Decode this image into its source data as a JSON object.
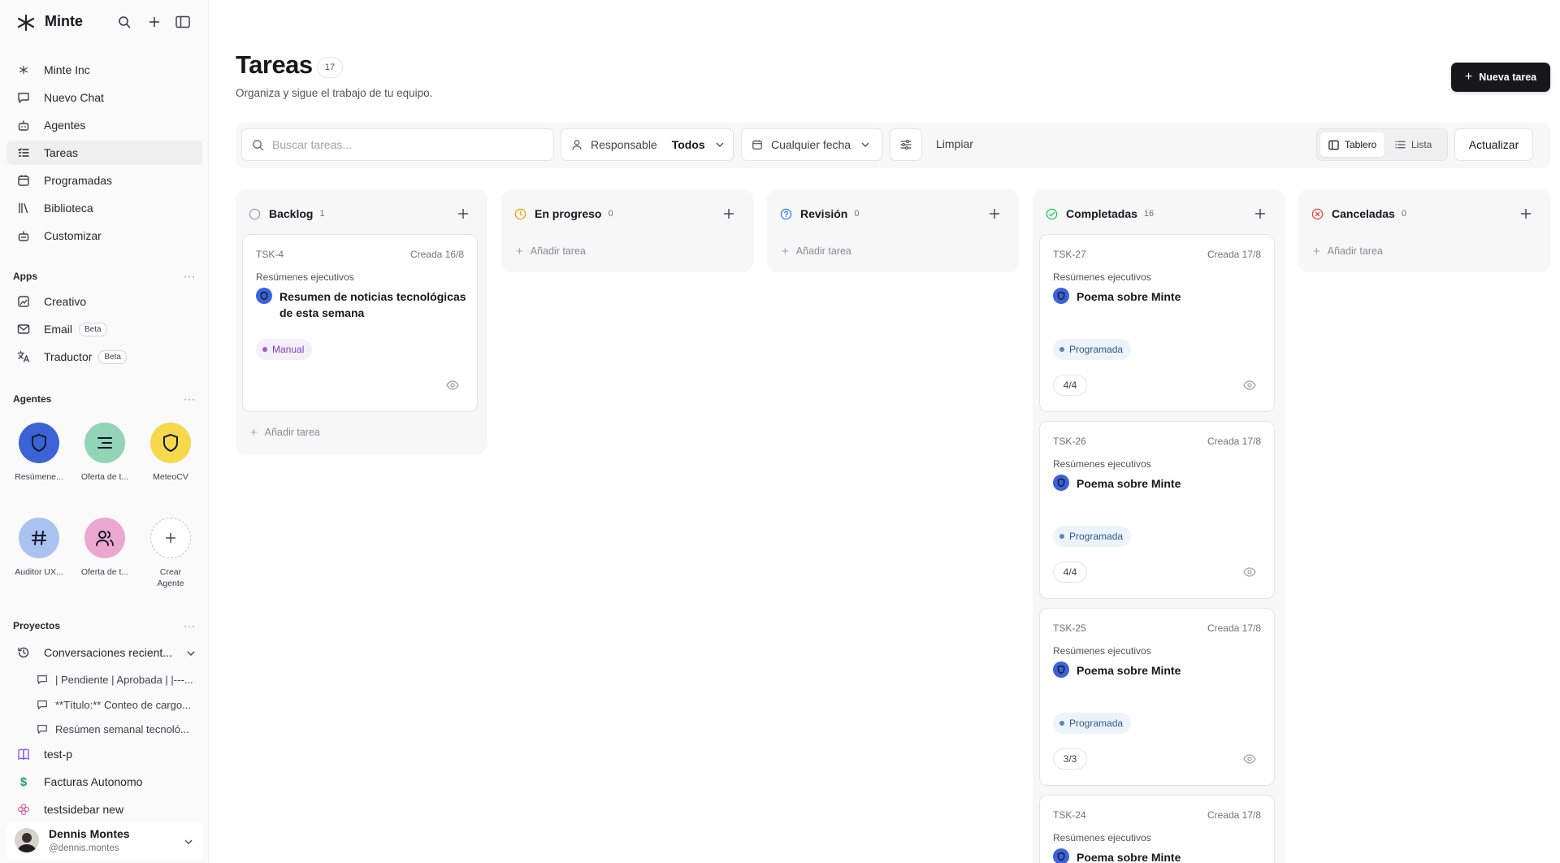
{
  "app": {
    "brand": "Minte"
  },
  "sidebar": {
    "nav": [
      {
        "label": "Minte Inc",
        "icon": "minte-logo-icon"
      },
      {
        "label": "Nuevo Chat",
        "icon": "chat-icon"
      },
      {
        "label": "Agentes",
        "icon": "bot-icon"
      },
      {
        "label": "Tareas",
        "icon": "list-check-icon",
        "active": true
      },
      {
        "label": "Programadas",
        "icon": "calendar-clock-icon"
      },
      {
        "label": "Biblioteca",
        "icon": "library-icon"
      },
      {
        "label": "Customizar",
        "icon": "bot-icon"
      }
    ],
    "apps_title": "Apps",
    "apps": [
      {
        "label": "Creativo",
        "icon": "image-edit-icon"
      },
      {
        "label": "Email",
        "icon": "mail-icon",
        "badge": "Beta"
      },
      {
        "label": "Traductor",
        "icon": "translate-icon",
        "badge": "Beta"
      }
    ],
    "agents_title": "Agentes",
    "agents": [
      {
        "name": "Resúmene...",
        "icon": "shield-icon",
        "color": "#3b63d6"
      },
      {
        "name": "Oferta de t...",
        "icon": "align-icon",
        "color": "#93d3b8"
      },
      {
        "name": "MeteoCV",
        "icon": "shield-icon",
        "color": "#f5d94a"
      },
      {
        "name": "Auditor UX...",
        "icon": "hash-icon",
        "color": "#a9c2ef"
      },
      {
        "name": "Oferta de t...",
        "icon": "users-icon",
        "color": "#eba7cf"
      },
      {
        "name": "Crear Agente",
        "icon": "plus-icon",
        "color": "#ffffff"
      }
    ],
    "projects_title": "Proyectos",
    "more": "···",
    "recent_label": "Conversaciones recient...",
    "recent": [
      "| Pendiente | Aprobada | |---...",
      "**Título:** Conteo de cargo...",
      "Resúmen semanal tecnoló..."
    ],
    "projects": [
      {
        "label": "test-p",
        "icon": "book-icon",
        "color": "#8b5cf6"
      },
      {
        "label": "Facturas Autonomo",
        "icon": "dollar-icon",
        "color": "#22a05a"
      },
      {
        "label": "testsidebar new",
        "icon": "flower-icon",
        "color": "#e26a9f"
      }
    ],
    "user": {
      "name": "Dennis Montes",
      "handle": "@dennis.montes"
    }
  },
  "header": {
    "title": "Tareas",
    "count": "17",
    "subtitle": "Organiza y sigue el trabajo de tu equipo.",
    "new_button": "Nueva tarea"
  },
  "toolbar": {
    "search_placeholder": "Buscar tareas...",
    "responsable_label": "Responsable",
    "responsable_value": "Todos",
    "date_label": "Cualquier fecha",
    "clear_label": "Limpiar",
    "view_board": "Tablero",
    "view_list": "Lista",
    "refresh": "Actualizar"
  },
  "board": {
    "add_task": "Añadir tarea",
    "columns": [
      {
        "title": "Backlog",
        "count": "1",
        "status_color": "#a1a1aa"
      },
      {
        "title": "En progreso",
        "count": "0",
        "status_color": "#f59e0b"
      },
      {
        "title": "Revisión",
        "count": "0",
        "status_color": "#3b82f6"
      },
      {
        "title": "Completadas",
        "count": "16",
        "status_color": "#22c55e"
      },
      {
        "title": "Canceladas",
        "count": "0",
        "status_color": "#ef4444"
      }
    ],
    "backlog_cards": [
      {
        "id": "TSK-4",
        "date": "Creada 16/8",
        "category": "Resúmenes ejecutivos",
        "title": "Resumen de noticias tecnológicas de esta semana",
        "tag": "Manual"
      }
    ],
    "completed_cards": [
      {
        "id": "TSK-27",
        "date": "Creada 17/8",
        "category": "Resúmenes ejecutivos",
        "title": "Poema sobre Minte",
        "tag": "Programada",
        "progress": "4/4"
      },
      {
        "id": "TSK-26",
        "date": "Creada 17/8",
        "category": "Resúmenes ejecutivos",
        "title": "Poema sobre Minte",
        "tag": "Programada",
        "progress": "4/4"
      },
      {
        "id": "TSK-25",
        "date": "Creada 17/8",
        "category": "Resúmenes ejecutivos",
        "title": "Poema sobre Minte",
        "tag": "Programada",
        "progress": "3/3"
      },
      {
        "id": "TSK-24",
        "date": "Creada 17/8",
        "category": "Resúmenes ejecutivos",
        "title": "Poema sobre Minte"
      }
    ]
  }
}
